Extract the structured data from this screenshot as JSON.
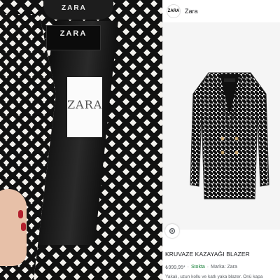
{
  "photo": {
    "hanger_brand": "ZARA",
    "neck_label": {
      "logo": "ZARA"
    },
    "hang_tag": {
      "logo": "ZARA"
    }
  },
  "header": {
    "site_name": "Zara",
    "icon_text": "ZARA"
  },
  "product": {
    "title": "KRUVAZE KAZAYAĞI BLAZER",
    "price": "₺999,95*",
    "separator": "·",
    "stock_status": "Stokta",
    "brand_label": "Marka: Zara",
    "description": "Yakalı, uzun kollu ve katlı yaka blazer. Önü kapa"
  },
  "colors": {
    "houndstooth_dark": "#111111",
    "houndstooth_light": "#f2f0ec",
    "in_stock": "#188038",
    "nail_polish": "#b2202e"
  },
  "icons": [
    "lens-icon"
  ]
}
